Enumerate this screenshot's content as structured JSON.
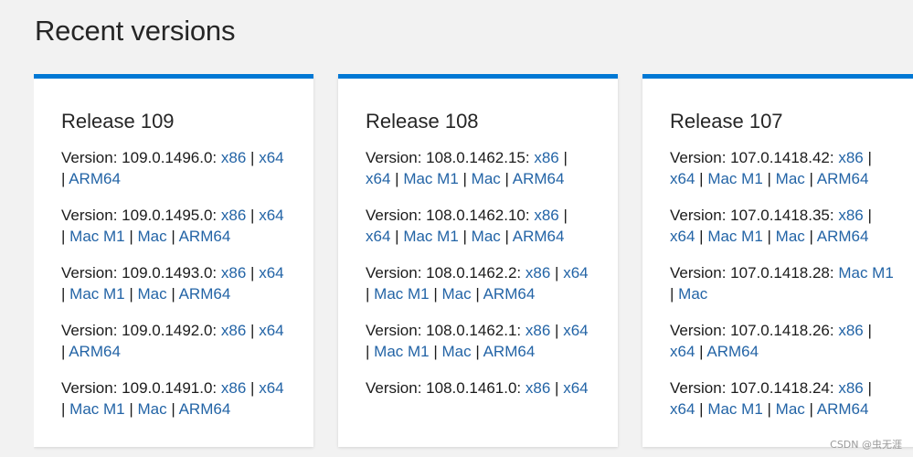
{
  "page": {
    "title": "Recent versions",
    "watermark": "CSDN @虫无涯"
  },
  "colors": {
    "accent": "#0078d4",
    "link": "#2364a6",
    "background": "#f2f2f2",
    "card": "#ffffff"
  },
  "version_prefix": "Version: ",
  "separator": "|",
  "releases": [
    {
      "title": "Release 109",
      "versions": [
        {
          "number": "109.0.1496.0",
          "links": [
            "x86",
            "x64",
            "ARM64"
          ]
        },
        {
          "number": "109.0.1495.0",
          "links": [
            "x86",
            "x64",
            "Mac M1",
            "Mac",
            "ARM64"
          ]
        },
        {
          "number": "109.0.1493.0",
          "links": [
            "x86",
            "x64",
            "Mac M1",
            "Mac",
            "ARM64"
          ]
        },
        {
          "number": "109.0.1492.0",
          "links": [
            "x86",
            "x64",
            "ARM64"
          ]
        },
        {
          "number": "109.0.1491.0",
          "links": [
            "x86",
            "x64",
            "Mac M1",
            "Mac",
            "ARM64"
          ]
        }
      ]
    },
    {
      "title": "Release 108",
      "versions": [
        {
          "number": "108.0.1462.15",
          "links": [
            "x86",
            "x64",
            "Mac M1",
            "Mac",
            "ARM64"
          ]
        },
        {
          "number": "108.0.1462.10",
          "links": [
            "x86",
            "x64",
            "Mac M1",
            "Mac",
            "ARM64"
          ]
        },
        {
          "number": "108.0.1462.2",
          "links": [
            "x86",
            "x64",
            "Mac M1",
            "Mac",
            "ARM64"
          ]
        },
        {
          "number": "108.0.1462.1",
          "links": [
            "x86",
            "x64",
            "Mac M1",
            "Mac",
            "ARM64"
          ]
        },
        {
          "number": "108.0.1461.0",
          "links": [
            "x86",
            "x64"
          ]
        }
      ]
    },
    {
      "title": "Release 107",
      "versions": [
        {
          "number": "107.0.1418.42",
          "links": [
            "x86",
            "x64",
            "Mac M1",
            "Mac",
            "ARM64"
          ]
        },
        {
          "number": "107.0.1418.35",
          "links": [
            "x86",
            "x64",
            "Mac M1",
            "Mac",
            "ARM64"
          ]
        },
        {
          "number": "107.0.1418.28",
          "links": [
            "Mac M1",
            "Mac"
          ]
        },
        {
          "number": "107.0.1418.26",
          "links": [
            "x86",
            "x64",
            "ARM64"
          ]
        },
        {
          "number": "107.0.1418.24",
          "links": [
            "x86",
            "x64",
            "Mac M1",
            "Mac",
            "ARM64"
          ]
        }
      ]
    }
  ]
}
